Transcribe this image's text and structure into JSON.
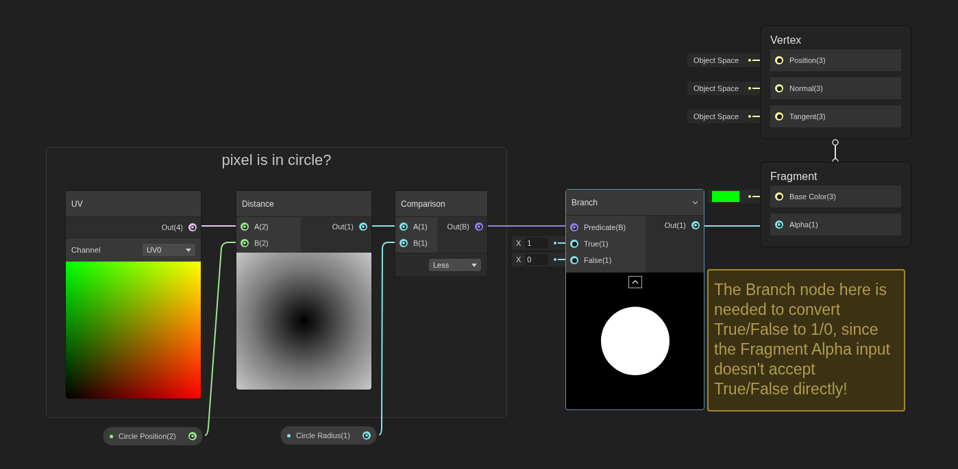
{
  "group": {
    "title": "pixel is in circle?"
  },
  "nodes": [
    {
      "kind": "uv",
      "title": "UV",
      "outputs": [
        {
          "label": "Out(4)",
          "color": "#e2c8ea",
          "connected": true
        }
      ],
      "channel": {
        "label": "Channel",
        "value": "UV0"
      }
    },
    {
      "kind": "distance",
      "title": "Distance",
      "inputs": [
        {
          "label": "A(2)",
          "color": "#9ae88e",
          "connected": true
        },
        {
          "label": "B(2)",
          "color": "#9ae88e",
          "connected": true
        }
      ],
      "outputs": [
        {
          "label": "Out(1)",
          "color": "#84e4e7",
          "connected": true
        }
      ]
    },
    {
      "kind": "comparison",
      "title": "Comparison",
      "inputs": [
        {
          "label": "A(1)",
          "color": "#84e4e7",
          "connected": true
        },
        {
          "label": "B(1)",
          "color": "#84e4e7",
          "connected": true
        }
      ],
      "outputs": [
        {
          "label": "Out(B)",
          "color": "#9481e6",
          "connected": true
        }
      ],
      "mode": "Less"
    },
    {
      "kind": "branch",
      "title": "Branch",
      "selected": true,
      "inputs": [
        {
          "label": "Predicate(B)",
          "color": "#9481e6",
          "connected": true
        },
        {
          "label": "True(1)",
          "color": "#84e4e7",
          "connected": false,
          "default": {
            "kind": "number",
            "axis": "X",
            "value": "1"
          }
        },
        {
          "label": "False(1)",
          "color": "#84e4e7",
          "connected": false,
          "default": {
            "kind": "number",
            "axis": "X",
            "value": "0"
          }
        }
      ],
      "outputs": [
        {
          "label": "Out(1)",
          "color": "#84e4e7",
          "connected": true
        }
      ]
    }
  ],
  "properties": [
    {
      "label": "Circle Position(2)",
      "color": "#9ae88e"
    },
    {
      "label": "Circle Radius(1)",
      "color": "#84e4e7"
    }
  ],
  "note": {
    "text": "The Branch node here is needed to convert True/False to 1/0, since the Fragment Alpha input doesn't accept True/False directly!"
  },
  "master": [
    {
      "title": "Vertex",
      "slots": [
        {
          "label": "Position(3)",
          "color": "#f6ff9a",
          "connected": false,
          "default": {
            "kind": "space",
            "text": "Object Space"
          }
        },
        {
          "label": "Normal(3)",
          "color": "#f6ff9a",
          "connected": false,
          "default": {
            "kind": "space",
            "text": "Object Space"
          }
        },
        {
          "label": "Tangent(3)",
          "color": "#f6ff9a",
          "connected": false,
          "default": {
            "kind": "space",
            "text": "Object Space"
          }
        }
      ]
    },
    {
      "title": "Fragment",
      "slots": [
        {
          "label": "Base Color(3)",
          "color": "#f6ff9a",
          "connected": false,
          "default": {
            "kind": "color",
            "color": "#00ff00"
          }
        },
        {
          "label": "Alpha(1)",
          "color": "#84e4e7",
          "connected": true
        }
      ]
    }
  ]
}
